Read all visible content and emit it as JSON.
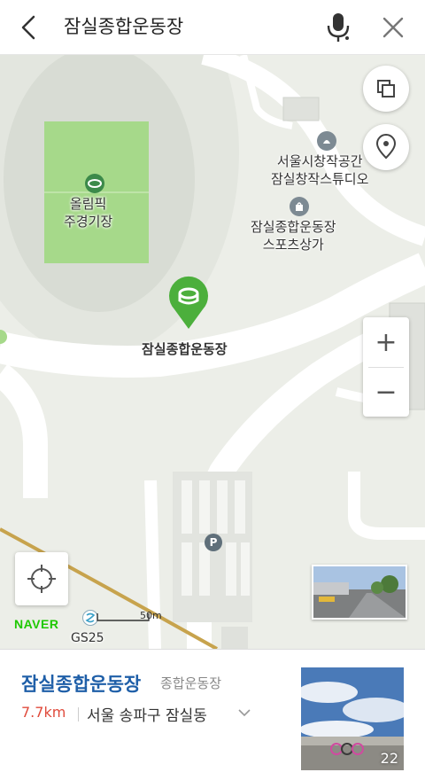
{
  "search": {
    "query": "잠실종합운동장"
  },
  "icons": {
    "back": "chevron-left-icon",
    "mic": "microphone-icon",
    "close": "close-icon",
    "layers": "layers-icon",
    "pin": "location-pin-icon",
    "zoom_in": "plus-icon",
    "zoom_out": "minus-icon",
    "locate": "crosshair-icon",
    "stadium": "stadium-icon"
  },
  "map": {
    "labels": {
      "olympic_stadium_1": "올림픽",
      "olympic_stadium_2": "주경기장",
      "seoul_art_1": "서울시창작공간",
      "seoul_art_2": "잠실창작스튜디오",
      "sports_mall_1": "잠실종합운동장",
      "sports_mall_2": "스포츠상가",
      "main_marker": "잠실종합운동장",
      "parking": "P",
      "gs25": "GS25"
    },
    "zoom_in": "+",
    "zoom_out": "−",
    "logo": "NAVER",
    "scale": "50m",
    "colors": {
      "marker": "#4caf3c",
      "field": "#a6d98a",
      "road": "#ffffff"
    }
  },
  "place": {
    "name": "잠실종합운동장",
    "category": "종합운동장",
    "distance": "7.7km",
    "address": "서울 송파구 잠실동",
    "photo_count": "22"
  }
}
